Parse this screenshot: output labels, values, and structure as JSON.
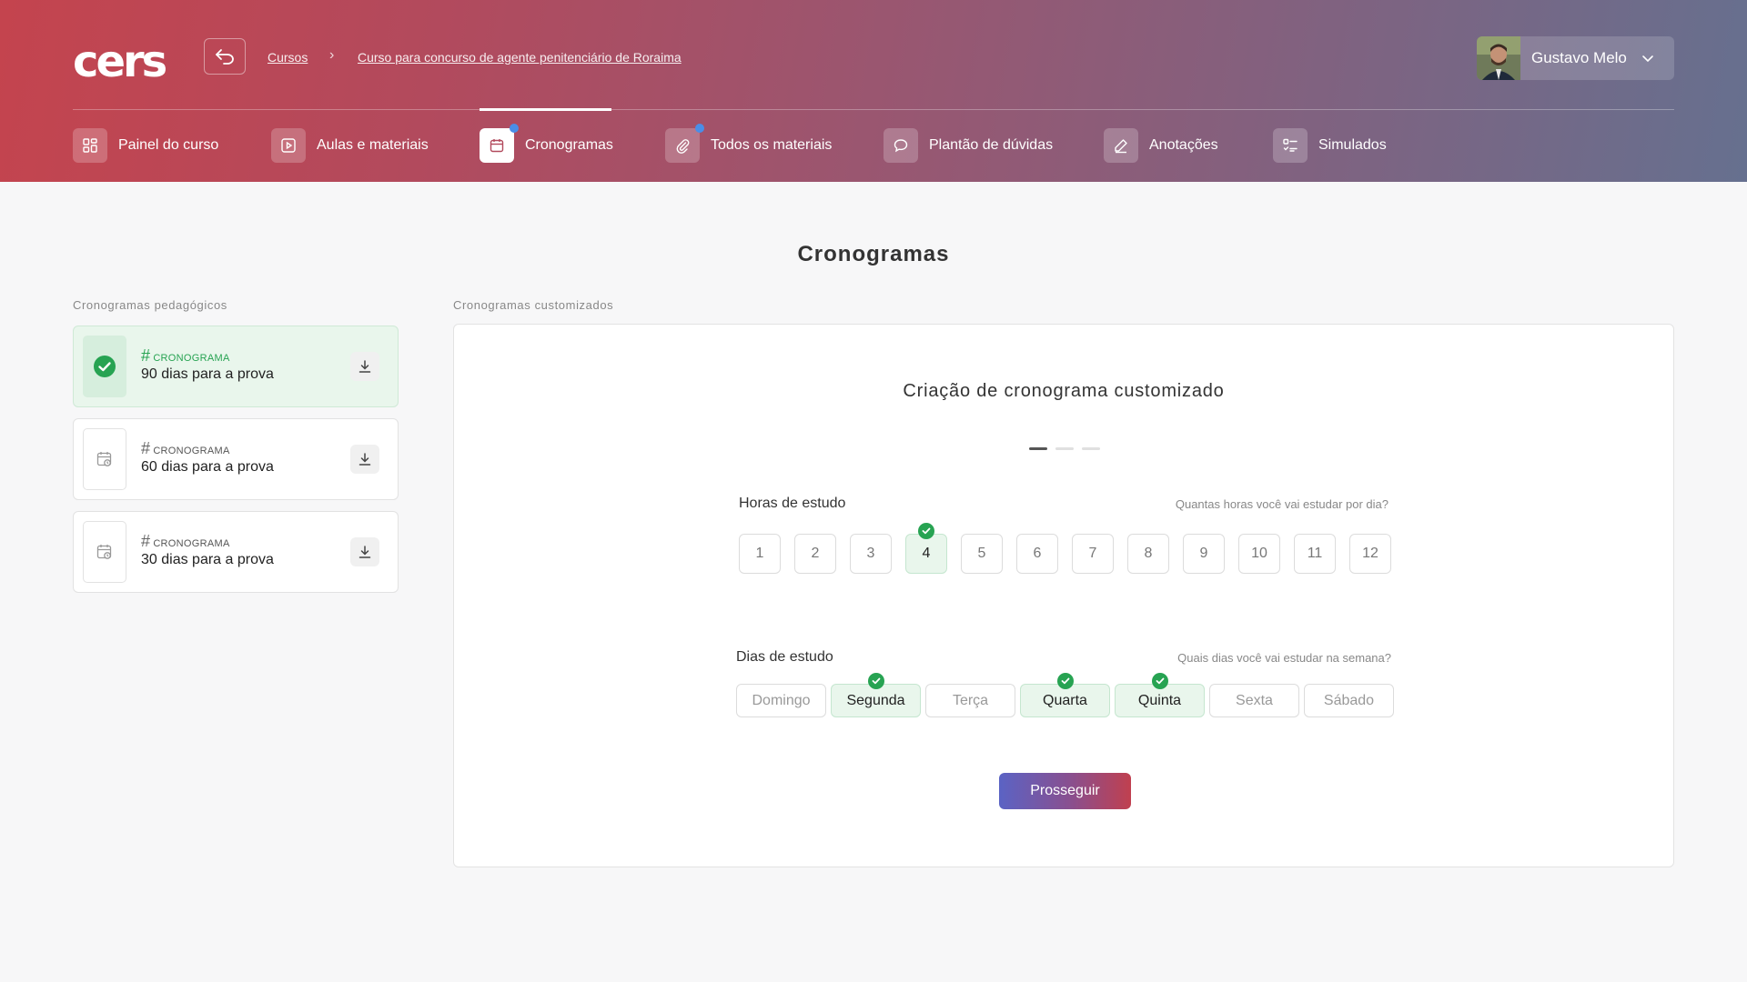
{
  "header": {
    "logo_text": "cers",
    "breadcrumb": [
      "Cursos",
      "Curso para concurso de agente penitenciário de Roraima"
    ],
    "user_name": "Gustavo Melo"
  },
  "nav": [
    {
      "label": "Painel do curso",
      "icon": "dashboard-icon",
      "active": false,
      "dot": false
    },
    {
      "label": "Aulas e materiais",
      "icon": "play-icon",
      "active": false,
      "dot": false
    },
    {
      "label": "Cronogramas",
      "icon": "calendar-icon",
      "active": true,
      "dot": true
    },
    {
      "label": "Todos os materiais",
      "icon": "paperclip-icon",
      "active": false,
      "dot": true
    },
    {
      "label": "Plantão de dúvidas",
      "icon": "chat-icon",
      "active": false,
      "dot": false
    },
    {
      "label": "Anotações",
      "icon": "pencil-icon",
      "active": false,
      "dot": false
    },
    {
      "label": "Simulados",
      "icon": "checklist-icon",
      "active": false,
      "dot": false
    }
  ],
  "page": {
    "title": "Cronogramas",
    "pedagogical_label": "Cronogramas pedagógicos",
    "custom_label": "Cronogramas customizados"
  },
  "schedules": [
    {
      "tag": "CRONOGRAMA",
      "title": "90 dias para a prova",
      "selected": true
    },
    {
      "tag": "CRONOGRAMA",
      "title": "60 dias para a prova",
      "selected": false
    },
    {
      "tag": "CRONOGRAMA",
      "title": "30 dias para a prova",
      "selected": false
    }
  ],
  "custom": {
    "title": "Criação de cronograma customizado",
    "steps_total": 3,
    "step_current": 1,
    "hours_label": "Horas de estudo",
    "hours_hint": "Quantas horas você vai estudar por dia?",
    "hours": [
      "1",
      "2",
      "3",
      "4",
      "5",
      "6",
      "7",
      "8",
      "9",
      "10",
      "11",
      "12"
    ],
    "hours_selected": "4",
    "days_label": "Dias de estudo",
    "days_hint": "Quais dias você vai estudar na semana?",
    "days": [
      {
        "label": "Domingo",
        "selected": false
      },
      {
        "label": "Segunda",
        "selected": true
      },
      {
        "label": "Terça",
        "selected": false
      },
      {
        "label": "Quarta",
        "selected": true
      },
      {
        "label": "Quinta",
        "selected": true
      },
      {
        "label": "Sexta",
        "selected": false
      },
      {
        "label": "Sábado",
        "selected": false
      }
    ],
    "cta_label": "Prosseguir"
  },
  "colors": {
    "accent_green": "#27a352",
    "header_start": "#c4444e",
    "header_end": "#66708f",
    "notification_dot": "#4a8ee8"
  }
}
